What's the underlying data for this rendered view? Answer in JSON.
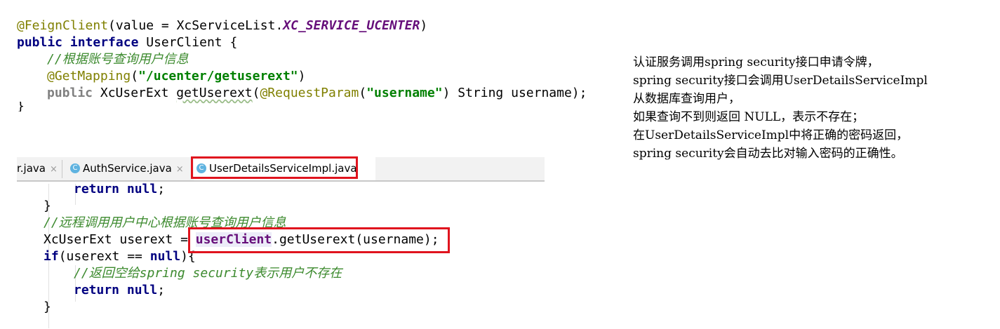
{
  "top_code": {
    "l1_ann": "@FeignClient",
    "l1_a": "(value = XcServiceList.",
    "l1_const": "XC_SERVICE_UCENTER",
    "l1_b": ")",
    "l2_kw1": "public",
    "l2_kw2": "interface",
    "l2_rest": " UserClient {",
    "l3_comment": "//根据账号查询用户信息",
    "l4_ann": "@GetMapping",
    "l4_a": "(",
    "l4_str": "\"/ucenter/getuserext\"",
    "l4_b": ")",
    "l5_kw": "public",
    "l5_a": " XcUserExt ",
    "l5_method": "getUserext",
    "l5_b": "(",
    "l5_ann": "@RequestParam",
    "l5_c": "(",
    "l5_str": "\"username\"",
    "l5_d": ") String username);",
    "l6": "}"
  },
  "tabs": [
    {
      "label": "r.java",
      "close": "×"
    },
    {
      "label": "AuthService.java",
      "close": "×",
      "icon": "C"
    },
    {
      "label": "UserDetailsServiceImpl.java",
      "icon": "C"
    }
  ],
  "bottom_code": {
    "b1_kw": "return",
    "b1_kw2": "null",
    "b1_rest": ";",
    "b2": "}",
    "b3_comment": "//远程调用用户中心根据账号查询用户信息",
    "b4_a": "XcUserExt userext = ",
    "b4_field": "userClient",
    "b4_b": ".getUserext(username);",
    "b5_kw": "if",
    "b5_a": "(userext == ",
    "b5_kw2": "null",
    "b5_b": "){",
    "b6_comment": "//返回空给spring security表示用户不存在",
    "b7_kw": "return",
    "b7_kw2": "null",
    "b7_rest": ";",
    "b8": "}"
  },
  "note": [
    "认证服务调用spring security接口申请令牌，",
    "spring security接口会调用UserDetailsServiceImpl",
    "从数据库查询用户，",
    "如果查询不到则返回 NULL，表示不存在；",
    "在UserDetailsServiceImpl中将正确的密码返回，",
    "spring security会自动去比对输入密码的正确性。"
  ],
  "colors": {
    "highlight_box": "#e0141e",
    "annotation": "#808000",
    "keyword": "#000080",
    "string": "#008000",
    "comment": "#3c8a2e",
    "constant": "#660e7a"
  }
}
